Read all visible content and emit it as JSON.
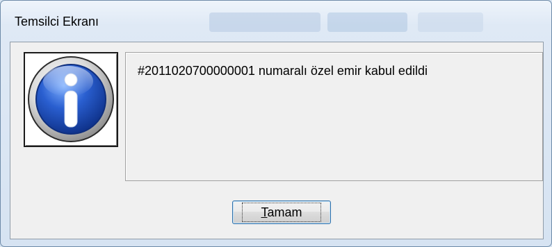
{
  "window": {
    "title": "Temsilci Ekranı"
  },
  "dialog": {
    "message": "#2011020700000001 numaralı özel emir kabul edildi",
    "icon": "information-icon",
    "button": {
      "accel": "T",
      "rest": "amam"
    }
  },
  "colors": {
    "icon_blue": "#1f4fb3",
    "button_focus_border": "#2d6ea8",
    "window_frame": "#d6e3f2"
  }
}
